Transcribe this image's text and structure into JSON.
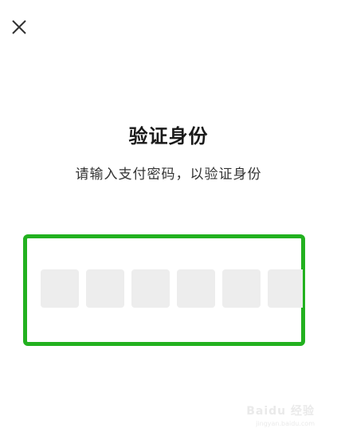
{
  "header": {
    "close_icon": "close-icon"
  },
  "dialog": {
    "title": "验证身份",
    "subtitle": "请输入支付密码，以验证身份"
  },
  "pin": {
    "digits": [
      "",
      "",
      "",
      "",
      "",
      ""
    ]
  },
  "colors": {
    "highlight": "#22b11f",
    "pin_box": "#ededed"
  },
  "watermark": {
    "text": "Baidu 经验",
    "sub": "jingyan.baidu.com"
  }
}
